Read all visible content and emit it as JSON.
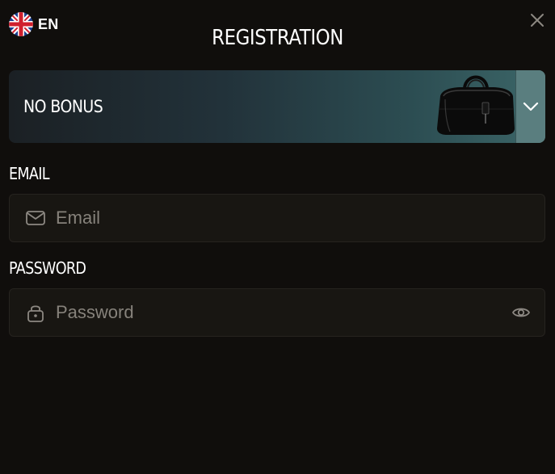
{
  "header": {
    "language": {
      "code": "EN",
      "flag_icon": "uk-flag-icon"
    },
    "title": "REGISTRATION",
    "close_icon": "close-icon"
  },
  "bonus": {
    "label": "NO BONUS",
    "image_icon": "leather-bag-image",
    "toggle_icon": "chevron-down-icon"
  },
  "form": {
    "email": {
      "label": "EMAIL",
      "placeholder": "Email",
      "value": "",
      "icon": "mail-icon"
    },
    "password": {
      "label": "PASSWORD",
      "placeholder": "Password",
      "value": "",
      "icon": "lock-icon",
      "toggle_icon": "eye-icon"
    }
  },
  "colors": {
    "background": "#100e0c",
    "input_background": "#181612",
    "bonus_gradient_start": "#1b2024",
    "bonus_gradient_end": "#3c6668",
    "placeholder": "#86827b"
  }
}
